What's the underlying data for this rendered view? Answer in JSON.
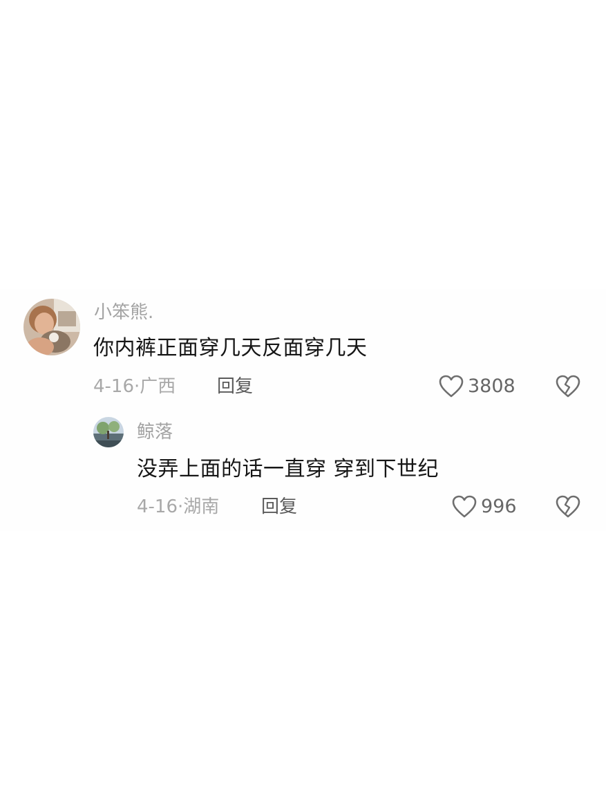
{
  "comments": [
    {
      "username": "小笨熊.",
      "content": "你内裤正面穿几天反面穿几天",
      "date": "4-16",
      "location": "广西",
      "meta_sep": "·",
      "reply_label": "回复",
      "likes": "3808",
      "like_icon": "heart-outline-icon",
      "dislike_icon": "broken-heart-icon"
    },
    {
      "username": "鲸落",
      "content": "没弄上面的话一直穿 穿到下世纪",
      "date": "4-16",
      "location": "湖南",
      "meta_sep": "·",
      "reply_label": "回复",
      "likes": "996",
      "like_icon": "heart-outline-icon",
      "dislike_icon": "broken-heart-icon"
    }
  ],
  "colors": {
    "username": "#a3a3a3",
    "content": "#161616",
    "meta": "#a8a8a8",
    "reply": "#5a5a5a",
    "icon": "#6e6e6e"
  }
}
